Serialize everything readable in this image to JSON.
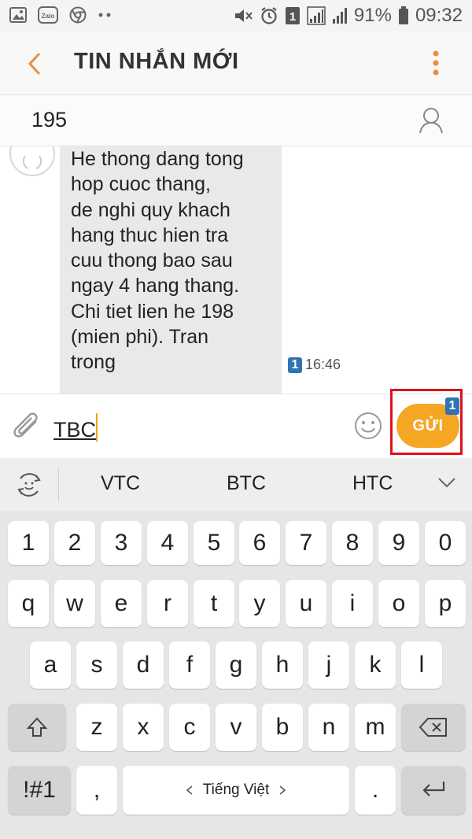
{
  "status_bar": {
    "left_icons": [
      "gallery-icon",
      "zalo-icon",
      "chrome-icon",
      "more-dots-icon"
    ],
    "zalo_label": "Zalo",
    "mute_icon": "mute-icon",
    "alarm_icon": "alarm-icon",
    "sim_label": "1",
    "battery_percent": "91%",
    "time": "09:32"
  },
  "header": {
    "title": "TIN NHẮN MỚI"
  },
  "recipient": {
    "number": "195"
  },
  "messages": [
    {
      "text": "He thong dang tong\nhop cuoc thang,\nde nghi quy khach\nhang thuc hien tra\ncuu thong bao sau\nngay 4 hang thang.\nChi tiet lien he 198\n(mien phi). Tran\ntrong",
      "sim": "1",
      "time": "16:46"
    }
  ],
  "composer": {
    "value": "TBC",
    "send_label": "GỬI",
    "send_sim": "1"
  },
  "keyboard": {
    "suggestions": [
      "VTC",
      "BTC",
      "HTC"
    ],
    "row_numbers": [
      "1",
      "2",
      "3",
      "4",
      "5",
      "6",
      "7",
      "8",
      "9",
      "0"
    ],
    "row1": [
      "q",
      "w",
      "e",
      "r",
      "t",
      "y",
      "u",
      "i",
      "o",
      "p"
    ],
    "row2": [
      "a",
      "s",
      "d",
      "f",
      "g",
      "h",
      "j",
      "k",
      "l"
    ],
    "row3": [
      "z",
      "x",
      "c",
      "v",
      "b",
      "n",
      "m"
    ],
    "symbols_label": "!#1",
    "comma_label": ",",
    "space_label": "Tiếng Việt",
    "period_label": "."
  },
  "colors": {
    "accent": "#f5a623",
    "highlight_box": "#e0101a",
    "sim_badge": "#2e74b5"
  }
}
